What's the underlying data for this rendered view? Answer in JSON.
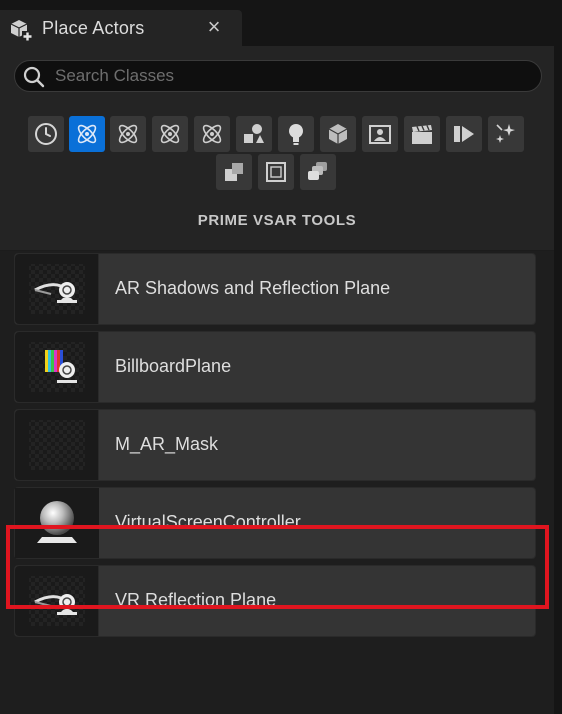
{
  "tab": {
    "title": "Place Actors",
    "close_glyph": "×",
    "icon": "place-actors-icon"
  },
  "search": {
    "placeholder": "Search Classes",
    "value": ""
  },
  "categories": [
    {
      "icon": "recently-placed-icon",
      "active": false
    },
    {
      "icon": "atom-icon",
      "active": true
    },
    {
      "icon": "atom-icon",
      "active": false
    },
    {
      "icon": "atom-icon",
      "active": false
    },
    {
      "icon": "atom-icon",
      "active": false
    },
    {
      "icon": "basic-shapes-icon",
      "active": false
    },
    {
      "icon": "lightbulb-icon",
      "active": false
    },
    {
      "icon": "cube-icon",
      "active": false
    },
    {
      "icon": "visual-effects-icon",
      "active": false
    },
    {
      "icon": "clapperboard-icon",
      "active": false
    },
    {
      "icon": "media-play-icon",
      "active": false
    },
    {
      "icon": "sparkles-icon",
      "active": false
    },
    {
      "icon": "geometry-stack-icon",
      "active": false
    },
    {
      "icon": "volume-square-icon",
      "active": false
    },
    {
      "icon": "layers-icon",
      "active": false
    }
  ],
  "section_title": "PRIME VSAR TOOLS",
  "actors": [
    {
      "label": "AR Shadows and Reflection Plane",
      "thumb": "camera-actor-icon"
    },
    {
      "label": "BillboardPlane",
      "thumb": "billboard-camera-icon"
    },
    {
      "label": "M_AR_Mask",
      "thumb": "empty-thumbnail"
    },
    {
      "label": "VirtualScreenController",
      "thumb": "sphere-actor-icon",
      "highlighted": true
    },
    {
      "label": "VR Reflection Plane",
      "thumb": "camera-actor-icon"
    }
  ],
  "colors": {
    "accent": "#0a70d8",
    "highlight": "#e0151f",
    "panel": "#242424",
    "item": "#343434"
  }
}
